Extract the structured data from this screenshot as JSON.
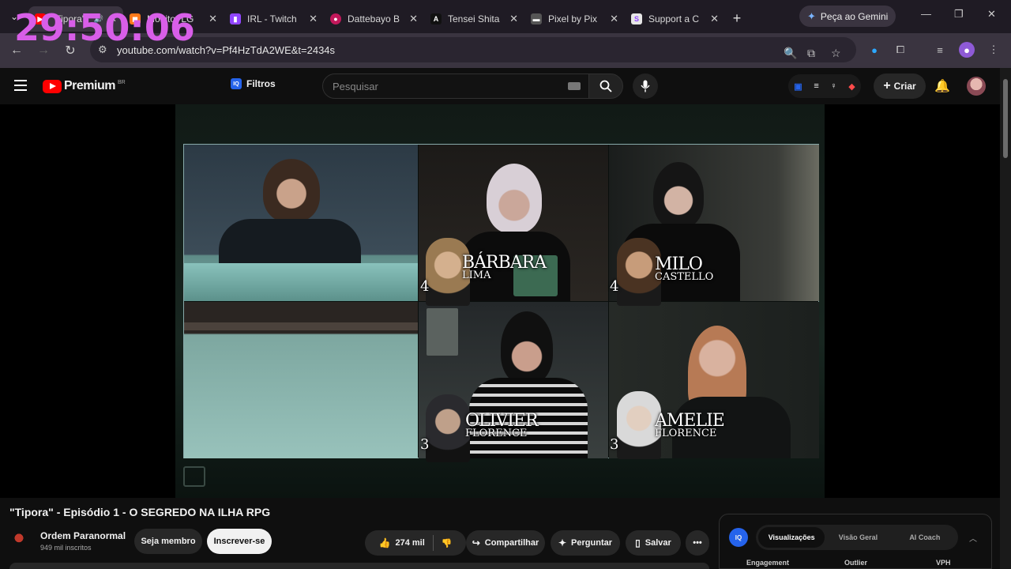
{
  "overlay": {
    "timer": "29:50:06"
  },
  "browser": {
    "tabs": [
      {
        "label": "\"Tipora\"",
        "color": "#ff0000",
        "glyph": "▶",
        "active": true,
        "audio": true
      },
      {
        "label": "Monitor LG",
        "color": "#ff7a1a",
        "glyph": "◼"
      },
      {
        "label": "IRL - Twitch",
        "color": "#9146ff",
        "glyph": "▮"
      },
      {
        "label": "Dattebayo B",
        "color": "#c2185b",
        "glyph": "●"
      },
      {
        "label": "Tensei Shita",
        "color": "#111111",
        "glyph": "A"
      },
      {
        "label": "Pixel by Pix",
        "color": "#555555",
        "glyph": "▬"
      },
      {
        "label": "Support a C",
        "color": "#e6e6e6",
        "glyph": "S"
      }
    ],
    "new_tab": "+",
    "gemini_label": "Peça ao Gemini",
    "url": "youtube.com/watch?v=Pf4HzTdA2WE&t=2434s"
  },
  "youtube": {
    "logo_word": "Premium",
    "logo_region": "BR",
    "filter_label": "Filtros",
    "iq_badge": "IQ",
    "search_placeholder": "Pesquisar",
    "create_label": "Criar"
  },
  "stream": {
    "players": [
      {
        "name": "BÁRBARA",
        "surname": "LIMA",
        "number": "4"
      },
      {
        "name": "MILO",
        "surname": "CASTELLO",
        "number": "4"
      },
      {
        "name": "OLIVIER",
        "surname": "FLORENCE",
        "number": "3"
      },
      {
        "name": "AMELIE",
        "surname": "FLORENCE",
        "number": "3"
      }
    ]
  },
  "video": {
    "title": "\"Tipora\" - Episódio 1 - O SEGREDO NA ILHA RPG",
    "channel": "Ordem Paranormal",
    "subscribers": "949 mil inscritos",
    "member_label": "Seja membro",
    "subscribe_label": "Inscrever-se",
    "likes": "274 mil",
    "share_label": "Compartilhar",
    "ask_label": "Perguntar",
    "save_label": "Salvar",
    "more_label": "•••"
  },
  "vidiq": {
    "logo": "IQ",
    "tabs": [
      "Visualizações",
      "Visão Geral",
      "AI Coach"
    ],
    "columns": [
      "Engagement",
      "Outlier",
      "VPH"
    ]
  }
}
